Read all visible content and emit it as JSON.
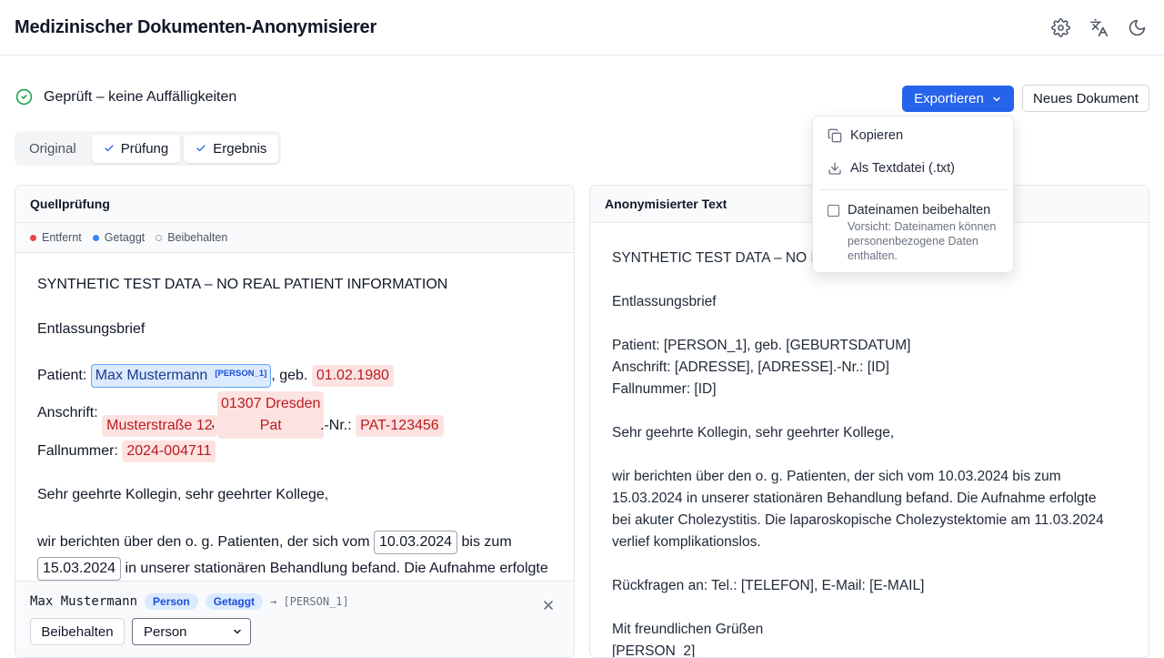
{
  "header": {
    "title": "Medizinischer Dokumenten-Anonymisierer",
    "icons": [
      "settings-icon",
      "translate-icon",
      "dark-mode-icon"
    ]
  },
  "status": {
    "text": "Geprüft – keine Auffälligkeiten",
    "icon": "check-circle-icon",
    "color": "#16a34a"
  },
  "toolbar": {
    "export_label": "Exportieren",
    "new_label": "Neues Dokument",
    "accent": "#2563eb"
  },
  "tabs": [
    {
      "label": "Original",
      "checked": false
    },
    {
      "label": "Prüfung",
      "checked": true
    },
    {
      "label": "Ergebnis",
      "checked": true
    }
  ],
  "export_menu": {
    "copy": "Kopieren",
    "txt": "Als Textdatei (.txt)",
    "keep_filename": "Dateinamen beibehalten",
    "warning": "Vorsicht: Dateinamen können personenbezogene Daten enthalten."
  },
  "source_panel": {
    "title": "Quellprüfung",
    "legend": {
      "removed": "Entfernt",
      "tagged": "Getaggt",
      "kept": "Beibehalten"
    },
    "l1": "SYNTHETIC TEST DATA – NO REAL PATIENT INFORMATION",
    "l2": "Entlassungsbrief",
    "patient_prefix": "Patient:",
    "patient_name": "Max Mustermann",
    "patient_tag": "[PERSON_1]",
    "geb": ", geb.",
    "dob": "01.02.1980",
    "address_prefix": "Anschrift:",
    "street": "Musterstraße 12",
    "comma": ",",
    "city": "01307 Dresden",
    "pat": "Pat",
    "nr": ".-Nr.:",
    "pat_id": "PAT-123456",
    "case_prefix": "Fallnummer:",
    "case_id": "2024-004711",
    "greeting": "Sehr geehrte Kollegin, sehr geehrter Kollege,",
    "p1": "wir berichten über den o. g. Patienten, der sich vom",
    "date_from": "10.03.2024",
    "p2": "bis zum",
    "date_to": "15.03.2024",
    "p3": "in unserer stationären Behandlung befand. Die Aufnahme erfolgte"
  },
  "detail": {
    "value": "Max Mustermann",
    "type": "Person",
    "state": "Getaggt",
    "replacement": "→ [PERSON_1]",
    "keep_label": "Beibehalten",
    "select_value": "Person"
  },
  "output_panel": {
    "title": "Anonymisierter Text",
    "text": "SYNTHETIC TEST DATA – NO RE\n\nEntlassungsbrief\n\nPatient: [PERSON_1], geb. [GEBURTSDATUM]\nAnschrift: [ADRESSE], [ADRESSE].-Nr.: [ID]\nFallnummer: [ID]\n\nSehr geehrte Kollegin, sehr geehrter Kollege,\n\nwir berichten über den o. g. Patienten, der sich vom 10.03.2024 bis zum\n15.03.2024 in unserer stationären Behandlung befand. Die Aufnahme erfolgte\nbei akuter Cholezystitis. Die laparoskopische Cholezystektomie am 11.03.2024\nverlief komplikationslos.\n\nRückfragen an: Tel.: [TELEFON], E-Mail: [E-MAIL]\n\nMit freundlichen Grüßen\n[PERSON_2]"
  }
}
